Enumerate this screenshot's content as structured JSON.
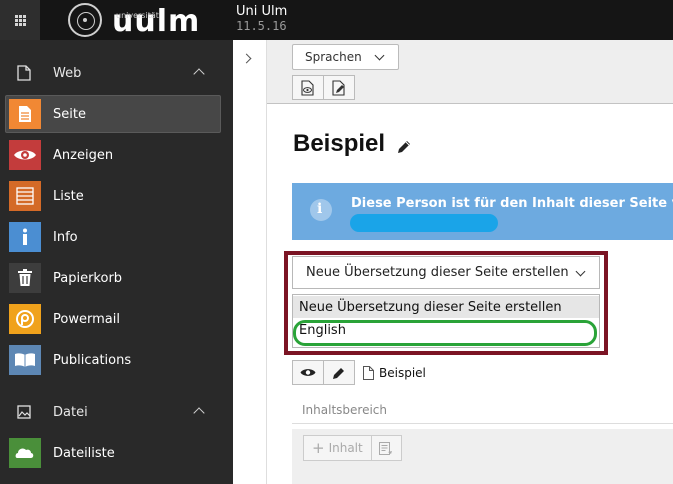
{
  "topbar": {
    "logo_small_text": "universität",
    "logo_text": "uulm",
    "site_name": "Uni Ulm",
    "version": "11.5.16"
  },
  "sidebar": {
    "web_label": "Web",
    "modules": [
      {
        "label": "Seite",
        "icon": "page-icon",
        "color": "#f18834"
      },
      {
        "label": "Anzeigen",
        "icon": "eye-icon",
        "color": "#c33c3c"
      },
      {
        "label": "Liste",
        "icon": "list-icon",
        "color": "#d46a27"
      },
      {
        "label": "Info",
        "icon": "info-icon",
        "color": "#4b8ed2"
      },
      {
        "label": "Papierkorb",
        "icon": "trash-icon",
        "color": "#3d3d3d"
      },
      {
        "label": "Powermail",
        "icon": "powermail-icon",
        "color": "#f0a21c"
      },
      {
        "label": "Publications",
        "icon": "book-icon",
        "color": "#5d87b4"
      }
    ],
    "datei_label": "Datei",
    "file_modules": [
      {
        "label": "Dateiliste",
        "icon": "folder-icon",
        "color": "#4a8f3a"
      }
    ]
  },
  "docheader": {
    "language_select": "Sprachen"
  },
  "content": {
    "title": "Beispiel",
    "info_message": "Diese Person ist für den Inhalt dieser Seite v",
    "translation_select": "Neue Übersetzung dieser Seite erstellen",
    "dropdown_options": [
      "Neue Übersetzung dieser Seite erstellen",
      "English"
    ],
    "page_ref": "Beispiel",
    "column_label": "Inhaltsbereich",
    "add_content_label": "Inhalt"
  },
  "colors": {
    "highlight_box": "#7b1424",
    "highlight_ring": "#2aa338",
    "info_bg": "#6daae0",
    "sidebar_bg": "#292929"
  }
}
